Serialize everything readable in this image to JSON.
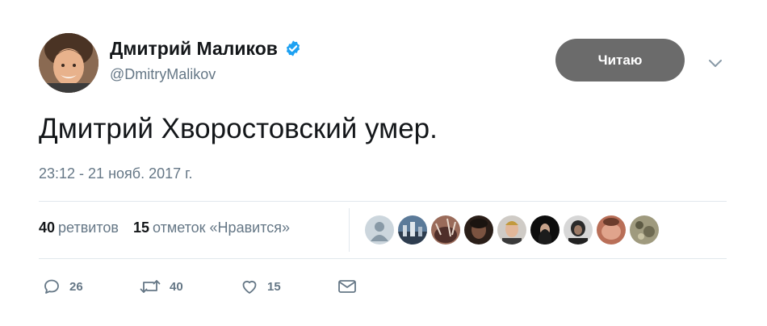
{
  "user": {
    "display_name": "Дмитрий Маликов",
    "handle": "@DmitryMalikov",
    "verified": true
  },
  "follow_button": {
    "label": "Читаю"
  },
  "tweet": {
    "text": "Дмитрий Хворостовский умер.",
    "timestamp": "23:12 - 21 нояб. 2017 г."
  },
  "stats": {
    "retweets_count": "40",
    "retweets_label": "ретвитов",
    "likes_count": "15",
    "likes_label": "отметок «Нравится»"
  },
  "likers": [
    {
      "icon": "default-avatar"
    },
    {
      "icon": "avatar-photo"
    },
    {
      "icon": "avatar-photo"
    },
    {
      "icon": "avatar-photo"
    },
    {
      "icon": "avatar-photo"
    },
    {
      "icon": "avatar-photo"
    },
    {
      "icon": "avatar-photo"
    },
    {
      "icon": "avatar-photo"
    },
    {
      "icon": "avatar-photo"
    }
  ],
  "actions": {
    "reply_count": "26",
    "retweet_count": "40",
    "like_count": "15"
  },
  "colors": {
    "text_primary": "#14171a",
    "text_secondary": "#657786",
    "verified_blue": "#1da1f2",
    "follow_button_bg": "#6b6b6b",
    "divider": "#e1e8ed"
  }
}
